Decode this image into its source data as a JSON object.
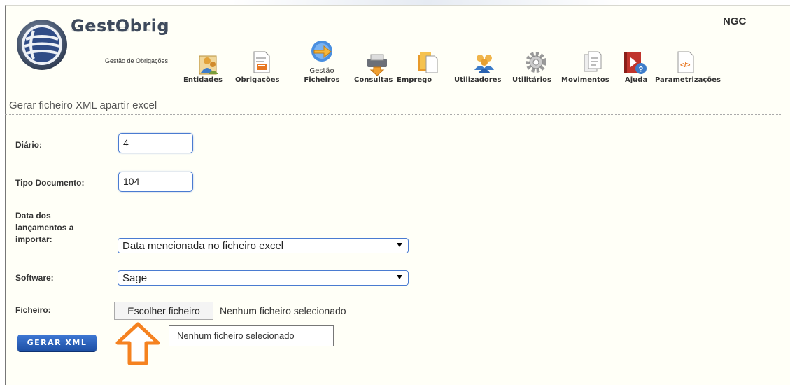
{
  "header": {
    "brand_name": "GestObrig",
    "brand_subtitle": "Gestão de Obrigações",
    "company": "NGC",
    "nav": [
      {
        "label": "Entidades",
        "icon": "people-book-icon"
      },
      {
        "label": "Obrigações",
        "icon": "document-stamp-icon"
      },
      {
        "label_line1": "Gestão",
        "label_line2": "Ficheiros",
        "icon": "file-exchange-icon"
      },
      {
        "label": "Consultas",
        "icon": "printer-icon"
      },
      {
        "label": "Emprego",
        "icon": "folder-documents-icon"
      },
      {
        "label": "Utilizadores",
        "icon": "users-icon"
      },
      {
        "label": "Utilitários",
        "icon": "gear-icon"
      },
      {
        "label": "Movimentos",
        "icon": "documents-stack-icon"
      },
      {
        "label": "Ajuda",
        "icon": "help-video-icon"
      },
      {
        "label": "Parametrizações",
        "icon": "code-document-icon"
      }
    ]
  },
  "page": {
    "title": "Gerar ficheiro XML apartir excel"
  },
  "form": {
    "diario_label": "Diário:",
    "diario_value": "4",
    "tipo_label": "Tipo Documento:",
    "tipo_value": "104",
    "data_label_line1": "Data dos",
    "data_label_line2": "lançamentos a",
    "data_label_line3": "importar:",
    "data_value": "Data mencionada no ficheiro excel",
    "software_label": "Software:",
    "software_value": "Sage",
    "ficheiro_label": "Ficheiro:",
    "file_button": "Escolher ficheiro",
    "file_status": "Nenhum ficheiro selecionado",
    "tooltip": "Nenhum ficheiro selecionado",
    "submit_label": "GERAR XML"
  },
  "colors": {
    "panel_bg": "#fffff7",
    "field_border": "#4a7bd1",
    "submit_bg": "#2a5fb8",
    "arrow_annotation": "#f58220"
  }
}
